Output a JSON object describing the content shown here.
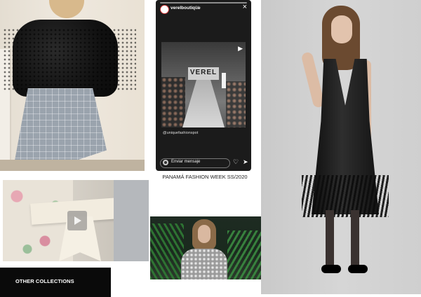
{
  "story": {
    "username": "verelboutique",
    "time": "9h",
    "close_icon": "×",
    "screen_text": "VEREL",
    "mention": "@uniquefashionspot",
    "reply_placeholder": "Enviar mensaje",
    "heart_icon": "♡",
    "send_icon": "➤",
    "play_icon": "▶"
  },
  "caption": "PANAMÁ FASHION WEEK SS/2020",
  "other_collections_label": "OTHER COLLECTIONS",
  "colors": {
    "background": "#ffffff",
    "button_bg": "#0a0a0a",
    "button_text": "#ffffff",
    "story_bg": "#1b1b1b"
  }
}
